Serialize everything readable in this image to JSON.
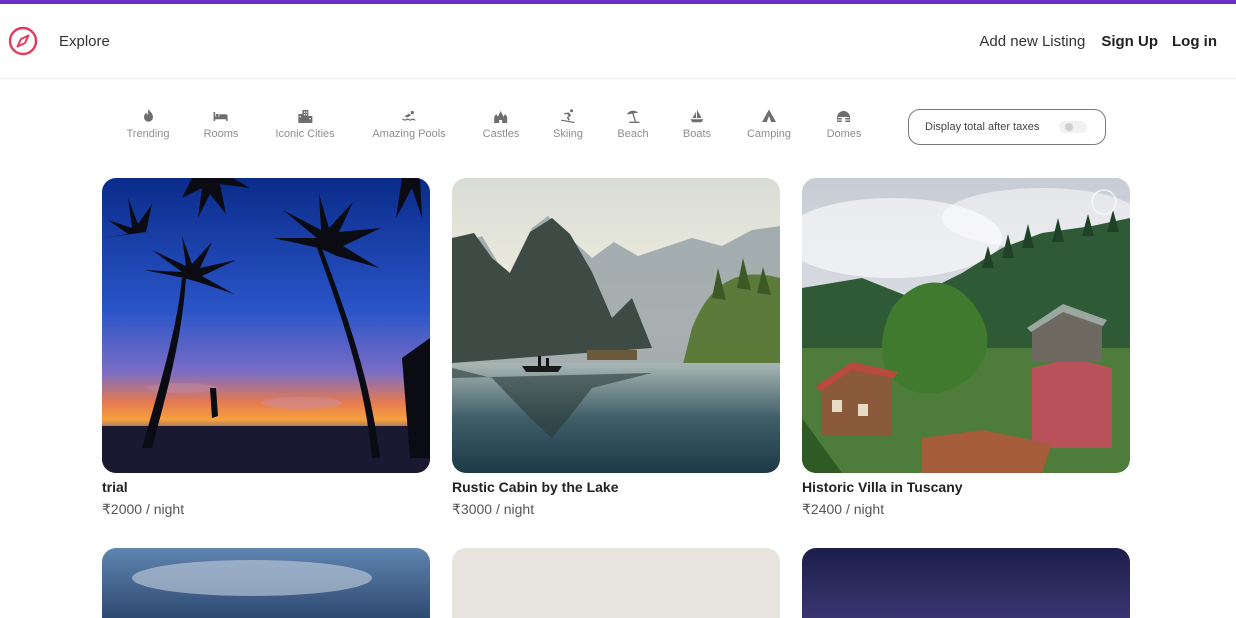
{
  "colors": {
    "accent": "#e8385c",
    "top_bar": "#6a2fc4"
  },
  "navbar": {
    "logo": "compass-icon",
    "explore": "Explore",
    "add_listing": "Add new Listing",
    "sign_up": "Sign Up",
    "log_in": "Log in"
  },
  "filters": [
    {
      "label": "Trending",
      "icon": "fire-icon"
    },
    {
      "label": "Rooms",
      "icon": "bed-icon"
    },
    {
      "label": "Iconic Cities",
      "icon": "city-icon"
    },
    {
      "label": "Amazing Pools",
      "icon": "pool-icon"
    },
    {
      "label": "Castles",
      "icon": "castle-icon"
    },
    {
      "label": "Skiing",
      "icon": "skiing-icon"
    },
    {
      "label": "Beach",
      "icon": "umbrella-icon"
    },
    {
      "label": "Boats",
      "icon": "sailboat-icon"
    },
    {
      "label": "Camping",
      "icon": "tent-icon"
    },
    {
      "label": "Domes",
      "icon": "igloo-icon"
    }
  ],
  "tax_toggle": {
    "label": "Display total after taxes",
    "enabled": false
  },
  "listings": [
    {
      "title": "trial",
      "price": "₹2000 / night",
      "image": "tropical-sunset-palms"
    },
    {
      "title": "Rustic Cabin by the Lake",
      "price": "₹3000 / night",
      "image": "lake-mountains-boat"
    },
    {
      "title": "Historic Villa in Tuscany",
      "price": "₹2400 / night",
      "image": "village-in-green-hills"
    }
  ]
}
